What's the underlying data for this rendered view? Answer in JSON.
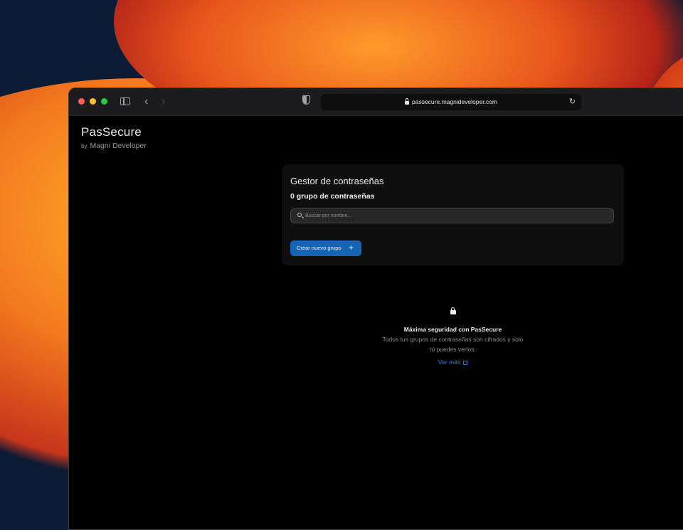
{
  "browser": {
    "url": "passecure.magnideveloper.com"
  },
  "brand": {
    "title": "PasSecure",
    "by": "by",
    "developer": "Magni Developer"
  },
  "card": {
    "title": "Gestor de contraseñas",
    "subtitle": "0 grupo de contraseñas",
    "search_placeholder": "Buscar por nombre...",
    "create_button": "Crear nuevo grupo",
    "create_icon": "+"
  },
  "info": {
    "title": "Máxima seguridad con PasSecure",
    "text": "Todos tus grupos de contraseñas son cifrados y solo tú puedes verlos.",
    "link": "Ver más"
  },
  "colors": {
    "accent": "#1565b4",
    "link": "#2f7fd6",
    "background": "#000000"
  },
  "icons": {
    "sidebar": "sidebar-icon",
    "back": "chevron-left-icon",
    "forward": "chevron-right-icon",
    "privacy": "shield-icon",
    "lock": "lock-icon",
    "reload": "reload-icon",
    "search": "search-icon",
    "external": "external-link-icon"
  }
}
